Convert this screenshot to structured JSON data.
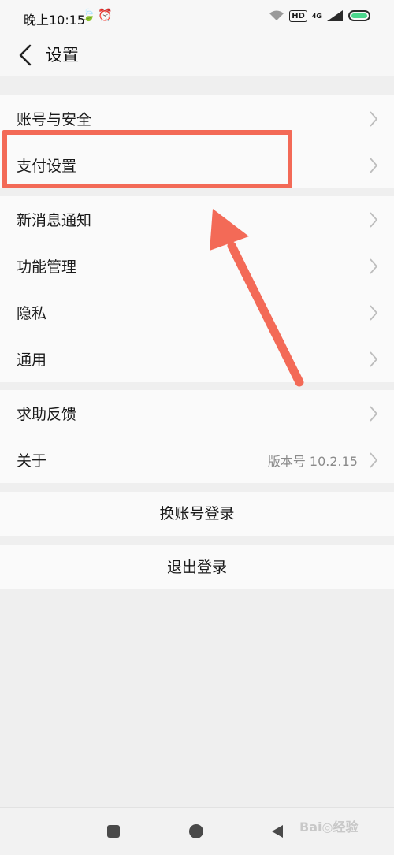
{
  "status_bar": {
    "time": "晚上10:15",
    "hd": "HD",
    "network": "4G",
    "battery_level": 1.0,
    "icons": [
      "leaf-icon",
      "alarm-icon",
      "wifi-icon",
      "signal-icon",
      "battery-icon"
    ]
  },
  "header": {
    "title": "设置"
  },
  "groups": {
    "account": [
      {
        "label": "账号与安全"
      },
      {
        "label": "支付设置"
      }
    ],
    "features": [
      {
        "label": "新消息通知"
      },
      {
        "label": "功能管理"
      },
      {
        "label": "隐私"
      },
      {
        "label": "通用"
      }
    ],
    "help": [
      {
        "label": "求助反馈"
      },
      {
        "label": "关于",
        "value": "版本号 10.2.15"
      }
    ]
  },
  "actions": {
    "switch_account": "换账号登录",
    "logout": "退出登录"
  },
  "annotation": {
    "highlight_color": "#f36a57",
    "highlighted_item": "支付设置"
  },
  "watermark": "Bai◎经验"
}
